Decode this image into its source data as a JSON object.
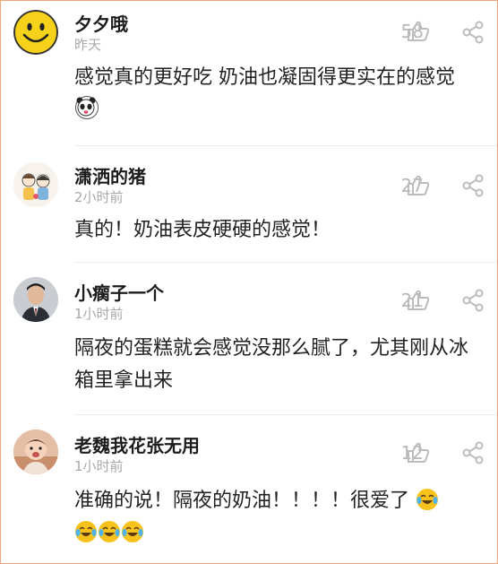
{
  "comments": [
    {
      "username": "夕夕哦",
      "time": "昨天",
      "likes": "58",
      "text": "感觉真的更好吃 奶油也凝固得更实在的感觉",
      "avatar": "smiley-face-icon",
      "trailing_emoji": "panda-face-emoji"
    },
    {
      "username": "潇洒的猪",
      "time": "2小时前",
      "likes": "27",
      "text": "真的！奶油表皮硬硬的感觉！",
      "avatar": "cartoon-couple-avatar"
    },
    {
      "username": "小瘸子一个",
      "time": "1小时前",
      "likes": "21",
      "text": "隔夜的蛋糕就会感觉没那么腻了，尤其刚从冰箱里拿出来",
      "avatar": "man-in-suit-avatar"
    },
    {
      "username": "老魏我花张无用",
      "time": "1小时前",
      "likes": "12",
      "text": "准确的说！隔夜的奶油！！！！很爱了",
      "avatar": "baby-photo-avatar",
      "trailing_emoji": "tears-of-joy-emoji"
    }
  ],
  "colors": {
    "text": "#222222",
    "meta": "#a8a8a8",
    "icons": "#b8b8b8",
    "border": "#f0a57a",
    "divider": "#ececec"
  }
}
